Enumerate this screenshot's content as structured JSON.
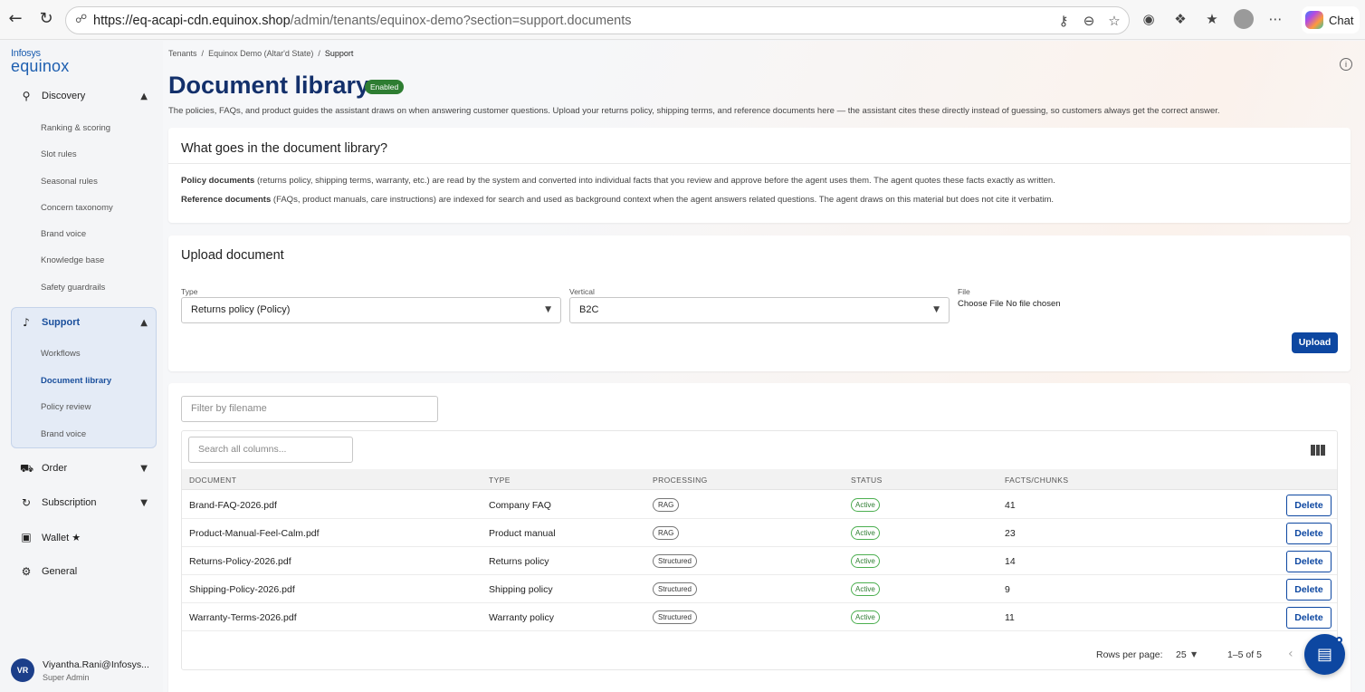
{
  "browser": {
    "url_host": "https://eq-acapi-cdn.equinox.shop",
    "url_path": "/admin/tenants/equinox-demo?section=support.documents",
    "chat_label": "Chat"
  },
  "brand": {
    "top": "Infosys",
    "bottom": "equinox"
  },
  "sidebar": {
    "discovery": {
      "label": "Discovery",
      "items": [
        "Ranking & scoring",
        "Slot rules",
        "Seasonal rules",
        "Concern taxonomy",
        "Brand voice",
        "Knowledge base",
        "Safety guardrails"
      ]
    },
    "support": {
      "label": "Support",
      "items": [
        "Workflows",
        "Document library",
        "Policy review",
        "Brand voice"
      ],
      "active": "Document library"
    },
    "order": "Order",
    "subscription": "Subscription",
    "wallet": "Wallet ★",
    "general": "General"
  },
  "user": {
    "initials": "VR",
    "name": "Viyantha.Rani@Infosys...",
    "role": "Super Admin"
  },
  "breadcrumb": {
    "tenants": "Tenants",
    "tenant": "Equinox Demo (Altar'd State)",
    "current": "Support",
    "sep": "/"
  },
  "page": {
    "title": "Document library",
    "badge": "Enabled",
    "subtitle": "The policies, FAQs, and product guides the assistant draws on when answering customer questions. Upload your returns policy, shipping terms, and reference documents here — the assistant cites these directly instead of guessing, so customers always get the correct answer."
  },
  "info_card": {
    "title": "What goes in the document library?",
    "policy_bold": "Policy documents",
    "policy_text": " (returns policy, shipping terms, warranty, etc.) are read by the system and converted into individual facts that you review and approve before the agent uses them. The agent quotes these facts exactly as written.",
    "reference_bold": "Reference documents",
    "reference_text": " (FAQs, product manuals, care instructions) are indexed for search and used as background context when the agent answers related questions. The agent draws on this material but does not cite it verbatim."
  },
  "upload": {
    "title": "Upload document",
    "type_label": "Type",
    "type_value": "Returns policy (Policy)",
    "vertical_label": "Vertical",
    "vertical_value": "B2C",
    "file_label": "File",
    "file_value": "Choose File No file chosen",
    "button": "Upload"
  },
  "table": {
    "filter_placeholder": "Filter by filename",
    "search_placeholder": "Search all columns...",
    "headers": {
      "document": "DOCUMENT",
      "type": "TYPE",
      "processing": "PROCESSING",
      "status": "STATUS",
      "facts": "FACTS/CHUNKS"
    },
    "rows": [
      {
        "document": "Brand-FAQ-2026.pdf",
        "type": "Company FAQ",
        "processing": "RAG",
        "status": "Active",
        "facts": "41",
        "action": "Delete"
      },
      {
        "document": "Product-Manual-Feel-Calm.pdf",
        "type": "Product manual",
        "processing": "RAG",
        "status": "Active",
        "facts": "23",
        "action": "Delete"
      },
      {
        "document": "Returns-Policy-2026.pdf",
        "type": "Returns policy",
        "processing": "Structured",
        "status": "Active",
        "facts": "14",
        "action": "Delete"
      },
      {
        "document": "Shipping-Policy-2026.pdf",
        "type": "Shipping policy",
        "processing": "Structured",
        "status": "Active",
        "facts": "9",
        "action": "Delete"
      },
      {
        "document": "Warranty-Terms-2026.pdf",
        "type": "Warranty policy",
        "processing": "Structured",
        "status": "Active",
        "facts": "11",
        "action": "Delete"
      }
    ],
    "pagination": {
      "rows_per_page_label": "Rows per page:",
      "rows_per_page": "25",
      "range": "1–5 of 5"
    }
  },
  "colors": {
    "primary": "#0d47a1",
    "title": "#13306b",
    "enabled": "#2e7d32",
    "active": "#4caf50"
  }
}
